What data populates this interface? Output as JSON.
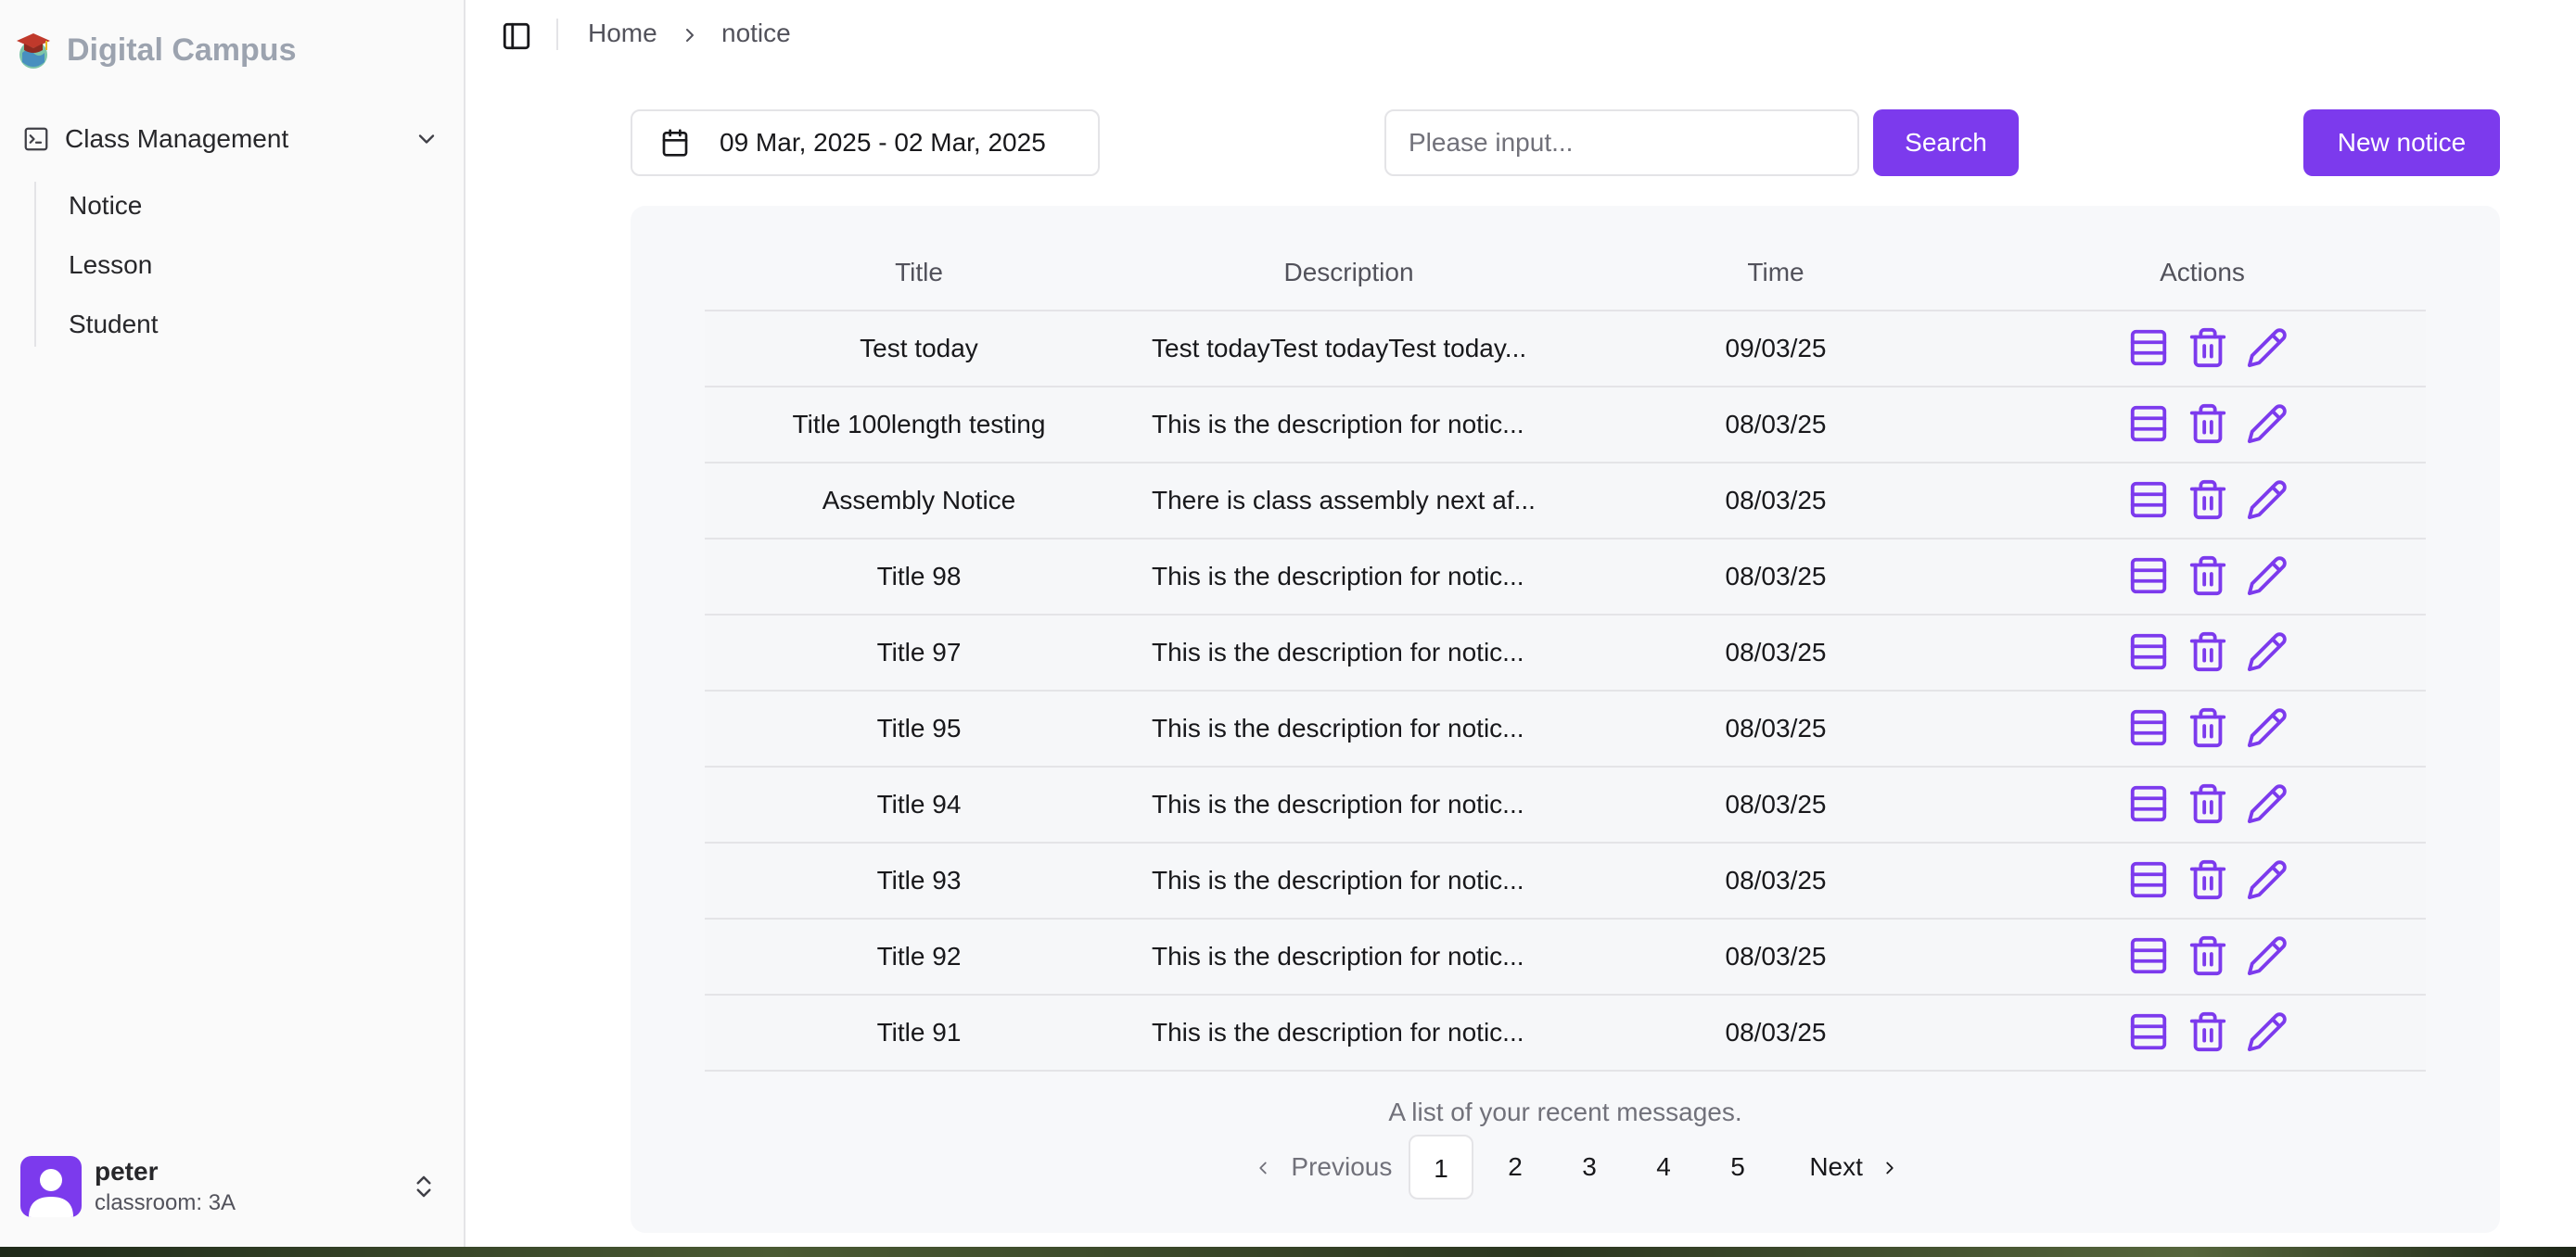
{
  "app": {
    "brand": "Digital Campus"
  },
  "sidebar": {
    "group": {
      "label": "Class Management"
    },
    "items": [
      {
        "label": "Notice"
      },
      {
        "label": "Lesson"
      },
      {
        "label": "Student"
      }
    ],
    "user": {
      "name": "peter",
      "subtitle": "classroom: 3A"
    }
  },
  "breadcrumb": {
    "home": "Home",
    "current": "notice"
  },
  "filters": {
    "date_range": "09 Mar, 2025 - 02 Mar, 2025",
    "search_placeholder": "Please input...",
    "search_label": "Search",
    "new_label": "New notice"
  },
  "table": {
    "columns": [
      "Title",
      "Description",
      "Time",
      "Actions"
    ],
    "rows": [
      {
        "title": "Test today",
        "description": "Test todayTest todayTest today...",
        "time": "09/03/25"
      },
      {
        "title": "Title 100length testing",
        "description": "This is the description for notic...",
        "time": "08/03/25"
      },
      {
        "title": "Assembly Notice",
        "description": "There is class assembly next af...",
        "time": "08/03/25"
      },
      {
        "title": "Title 98",
        "description": "This is the description for notic...",
        "time": "08/03/25"
      },
      {
        "title": "Title 97",
        "description": "This is the description for notic...",
        "time": "08/03/25"
      },
      {
        "title": "Title 95",
        "description": "This is the description for notic...",
        "time": "08/03/25"
      },
      {
        "title": "Title 94",
        "description": "This is the description for notic...",
        "time": "08/03/25"
      },
      {
        "title": "Title 93",
        "description": "This is the description for notic...",
        "time": "08/03/25"
      },
      {
        "title": "Title 92",
        "description": "This is the description for notic...",
        "time": "08/03/25"
      },
      {
        "title": "Title 91",
        "description": "This is the description for notic...",
        "time": "08/03/25"
      }
    ],
    "caption": "A list of your recent messages."
  },
  "pagination": {
    "previous": "Previous",
    "next": "Next",
    "pages": [
      "1",
      "2",
      "3",
      "4",
      "5"
    ],
    "current": "1"
  },
  "colors": {
    "accent": "#7c3aed",
    "sidebar_bg": "#fafafa",
    "card_bg": "#f7f8fa",
    "border": "#e4e4e7"
  },
  "icons": {
    "logo": "graduation-cap-globe-logo",
    "group": "terminal-square-icon",
    "row_actions": [
      "list-icon",
      "trash-icon",
      "pencil-icon"
    ]
  }
}
